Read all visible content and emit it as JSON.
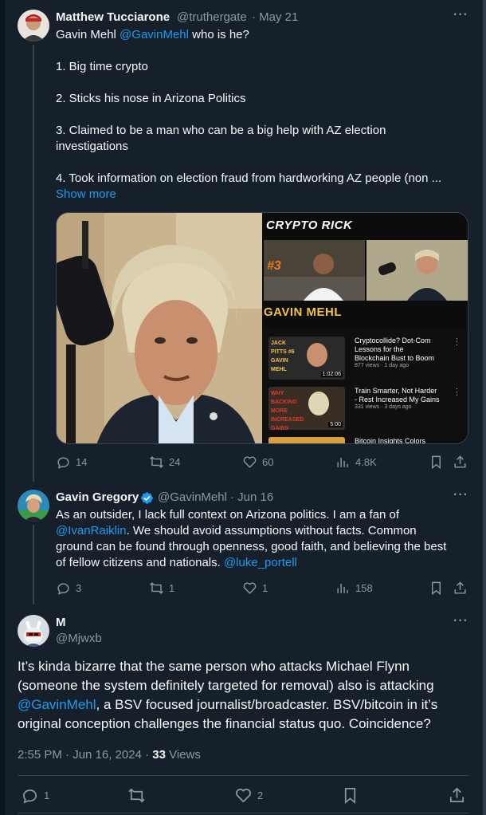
{
  "tweet1": {
    "name": "Matthew Tucciarone",
    "handle": "@truthergate",
    "date": "· May 21",
    "line1_pre": "Gavin Mehl ",
    "line1_mention": "@GavinMehl",
    "line1_post": " who is he?",
    "item1": "1. Big time crypto",
    "item2": "2. Sticks his nose in Arizona Politics",
    "item3a": "3. Claimed to be a man who can be a big help with AZ election",
    "item3b": "investigations",
    "item4": "4. Took information on election fraud from hardworking AZ people (non ...",
    "show_more": "Show more",
    "replies": "14",
    "reposts": "24",
    "likes": "60",
    "views": "4.8K"
  },
  "media": {
    "panel_title": "CRYPTO RICK",
    "episode": "#3",
    "guest": "GAVIN MEHL",
    "videos": [
      {
        "thumb_text": "JACK PITTS #6 GAVIN MEHL",
        "title1": "Cryptocollide? Dot-Com",
        "title2": "Lessons for the",
        "title3": "Blockchain Bust to Boom",
        "meta": "877 views · 1 day ago",
        "duration": "1:02:06"
      },
      {
        "thumb_text": "WHY BACKING MORE INCREASED GAINS",
        "title1": "Train Smarter, Not Harder",
        "title2": "- Rest Increased My Gains",
        "title3": "",
        "meta": "331 views · 3 days ago",
        "duration": "5:00"
      },
      {
        "thumb_text": "",
        "title1": "Bitcoin Insights Colors",
        "title2": "",
        "title3": "",
        "meta": "",
        "duration": ""
      }
    ]
  },
  "tweet2": {
    "name": "Gavin Gregory",
    "handle": "@GavinMehl",
    "date": "· Jun 16",
    "line1": "As an outsider, I lack full context on Arizona politics. I am a fan of",
    "line2_mention": "@IvanRaiklin",
    "line2_post": ". We should avoid assumptions without facts. Common",
    "line3": "ground can be found through openness, good faith, and believing the best",
    "line4": "of fellow citizens and nationals. ",
    "line4_mention": "@luke_portell",
    "replies": "3",
    "reposts": "1",
    "likes": "1",
    "views": "158"
  },
  "tweet3": {
    "name": "M",
    "handle": "@Mjwxb",
    "line1": "It’s kinda bizarre that the same person who attacks Michael Flynn",
    "line2": "(someone the system definitely targeted for removal) also is attacking",
    "line3_mention": "@GavinMehl",
    "line3_post": ", a BSV focused journalist/broadcaster.  BSV/bitcoin in it’s",
    "line4": "original conception challenges the financial status quo.  Coincidence?",
    "timestamp": "2:55 PM · Jun 16, 2024 · ",
    "views_count": "33",
    "views_label": " Views",
    "replies": "1",
    "likes": "2"
  },
  "icons": {
    "more": "more-icon",
    "reply": "reply-icon",
    "repost": "repost-icon",
    "like": "like-icon",
    "views": "views-icon",
    "bookmark": "bookmark-icon",
    "share": "share-icon",
    "verified": "verified-badge-icon"
  },
  "colors": {
    "background": "#15202b",
    "accent": "#1d9bf0",
    "secondary_text": "#8b98a5",
    "border": "#38444d"
  }
}
